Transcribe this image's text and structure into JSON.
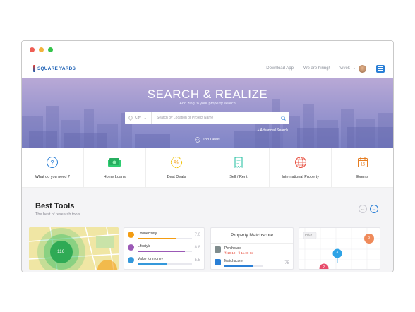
{
  "nav": {
    "logo": "SQUARE YARDS",
    "download": "Download App",
    "hiring": "We are hiring!",
    "user": "Vivek"
  },
  "hero": {
    "title": "SEARCH & REALIZE",
    "subtitle": "Add zing to your property search",
    "city_label": "City",
    "search_placeholder": "Search by Location or Project Name",
    "advanced": "+ Advanced Search",
    "top_deals": "Top Deals"
  },
  "categories": [
    {
      "label": "What do you need ?",
      "icon": "question-icon"
    },
    {
      "label": "Home Loans",
      "icon": "money-icon"
    },
    {
      "label": "Best Deals",
      "icon": "percent-badge-icon"
    },
    {
      "label": "Sell / Rent",
      "icon": "receipt-icon"
    },
    {
      "label": "International Property",
      "icon": "globe-icon"
    },
    {
      "label": "Events",
      "icon": "calendar-icon",
      "calendar_day": "15"
    }
  ],
  "tools": {
    "title": "Best Tools",
    "subtitle": "The best of research tools.",
    "map": {
      "cluster_count": "116"
    },
    "metrics": [
      {
        "label": "Connectivity",
        "value": "7.0",
        "color": "#f39c12",
        "fill": 0.7
      },
      {
        "label": "Lifestyle",
        "value": "8.8",
        "color": "#9b59b6",
        "fill": 0.88
      },
      {
        "label": "Value for money",
        "value": "5.5",
        "color": "#3498db",
        "fill": 0.55
      }
    ],
    "matchscore": {
      "title": "Property Matchscore",
      "row1_label": "Penthouse",
      "row1_price": "₹ 10.10 - ₹ 11.00 Cr",
      "row2_label": "Matchscore",
      "row2_value": "75"
    },
    "price_chart": {
      "label": "Price",
      "bubbles": [
        "3",
        "3",
        "2"
      ]
    }
  },
  "colors": {
    "accent": "#2a7fd6",
    "red_dot": "#ee5e55",
    "yellow_dot": "#f2b33d",
    "green_dot": "#35c44b"
  }
}
